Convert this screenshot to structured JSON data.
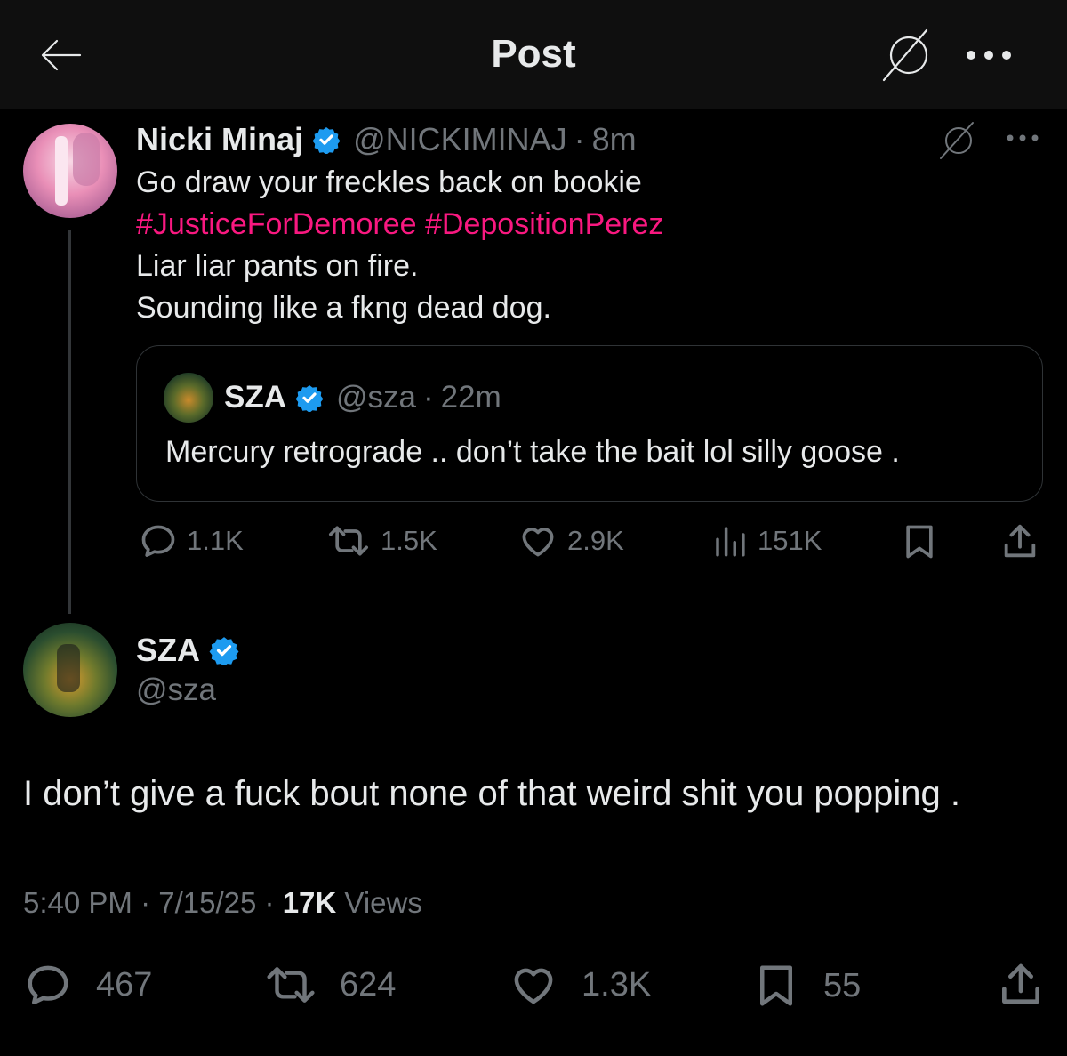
{
  "header": {
    "title": "Post",
    "back_icon": "arrow-left-icon",
    "grok_icon": "grok-slash-icon",
    "more_icon": "more-dots-icon"
  },
  "parent_post": {
    "author_name": "Nicki Minaj",
    "handle": "@NICKIMINAJ",
    "time": "8m",
    "lines": [
      "Go draw your freckles back on bookie"
    ],
    "hashtags": [
      "#JusticeForDemoree",
      "#DepositionPerez"
    ],
    "lines_after": [
      "Liar liar pants on fire.",
      "Sounding like a fkng dead dog."
    ],
    "quoted": {
      "author_name": "SZA",
      "handle": "@sza",
      "time": "22m",
      "text": "Mercury retrograde .. don’t take the bait lol silly goose ."
    },
    "stats": {
      "replies": "1.1K",
      "reposts": "1.5K",
      "likes": "2.9K",
      "views": "151K"
    }
  },
  "main_post": {
    "author_name": "SZA",
    "handle": "@sza",
    "text": "I don’t give a fuck bout none of that weird shit you popping .",
    "time": "5:40 PM",
    "date": "7/15/25",
    "views_count": "17K",
    "views_label": "Views",
    "stats": {
      "replies": "467",
      "reposts": "624",
      "likes": "1.3K",
      "bookmarks": "55"
    }
  },
  "colors": {
    "background": "#000000",
    "text": "#e7e9ea",
    "muted": "#71767b",
    "hashtag": "#f91880",
    "verified": "#1d9bf0"
  }
}
